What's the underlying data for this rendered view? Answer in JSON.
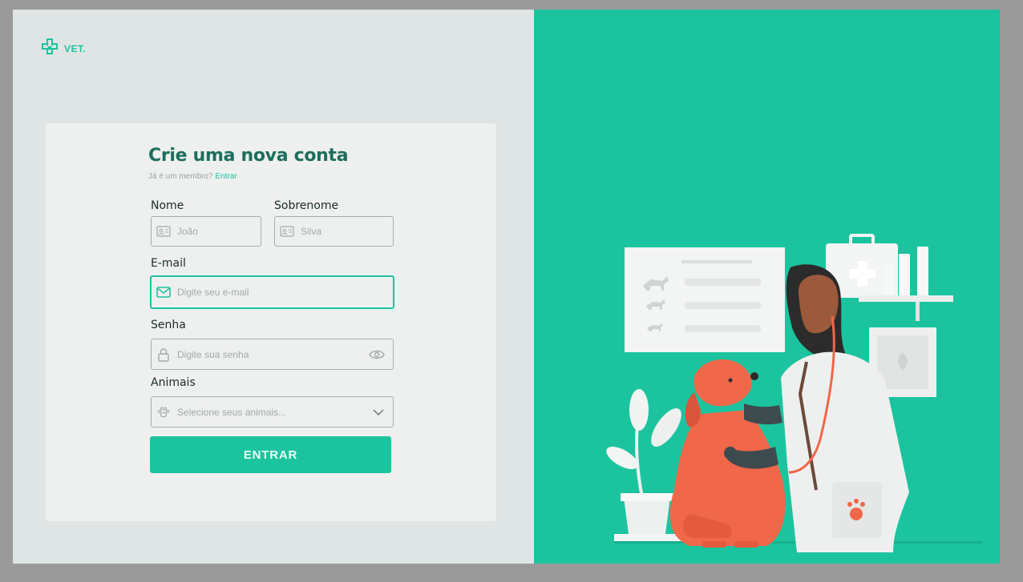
{
  "brand": {
    "logo_text": "VET."
  },
  "form": {
    "title": "Crie uma nova conta",
    "member_prompt": "Já é um membro?",
    "login_link": "Entrar",
    "first_name": {
      "label": "Nome",
      "placeholder": "João"
    },
    "last_name": {
      "label": "Sobrenome",
      "placeholder": "Silva"
    },
    "email": {
      "label": "E-mail",
      "placeholder": "Digite seu e-mail"
    },
    "password": {
      "label": "Senha",
      "placeholder": "Digite sua senha"
    },
    "animals": {
      "label": "Animais",
      "placeholder": "Selecione seus animais..."
    },
    "submit_label": "ENTRAR"
  },
  "colors": {
    "accent": "#1bc49e",
    "panel": "#dfe5e4",
    "card": "#eef0ef",
    "title": "#1d6e5c",
    "dog": "#f0674a"
  },
  "icons": {
    "logo": "paw-cross-icon",
    "first_name": "id-card-icon",
    "last_name": "id-card-icon",
    "email": "mail-icon",
    "password": "lock-icon",
    "password_toggle": "eye-icon",
    "animals": "paw-icon",
    "dropdown": "chevron-down-icon"
  }
}
